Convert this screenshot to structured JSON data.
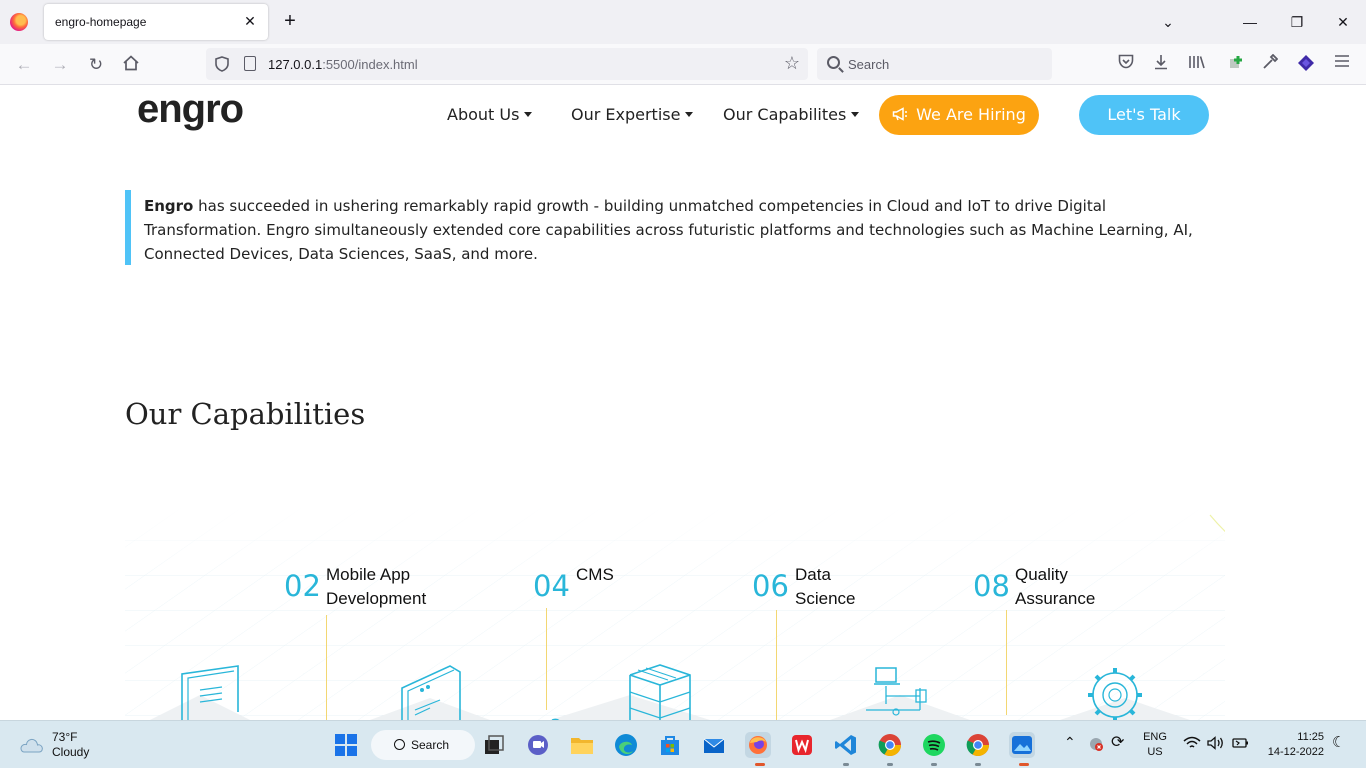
{
  "browser": {
    "tab_title": "engro-homepage",
    "tab_close": "✕",
    "new_tab": "+",
    "url_host": "127.0.0.1",
    "url_rest": ":5500/index.html",
    "search_placeholder": "Search",
    "window_controls": {
      "minimize": "—",
      "restore": "❐",
      "close": "✕"
    },
    "list_tabs": "⌄"
  },
  "site": {
    "logo": "engro",
    "nav": [
      {
        "label": "About Us"
      },
      {
        "label": "Our Expertise"
      },
      {
        "label": "Our Capabilites"
      }
    ],
    "hiring_button": "We Are Hiring",
    "talk_button": "Let's Talk",
    "intro_bold": "Engro",
    "intro_text": " has succeeded in ushering remarkably rapid growth - building unmatched competencies in Cloud and IoT to drive Digital Transformation. Engro simultaneously extended core capabilities across futuristic platforms and technologies such as Machine Learning, AI, Connected Devices, Data Sciences, SaaS, and more.",
    "capabilities_heading": "Our Capabilities",
    "capabilities": [
      {
        "number": "02",
        "line1": "Mobile App",
        "line2": "Development"
      },
      {
        "number": "04",
        "line1": "CMS",
        "line2": ""
      },
      {
        "number": "06",
        "line1": "Data",
        "line2": "Science"
      },
      {
        "number": "08",
        "line1": "Quality",
        "line2": "Assurance"
      }
    ],
    "accent_colors": {
      "blue": "#4fc3f7",
      "orange": "#fca311",
      "number_blue": "#29b6d9"
    }
  },
  "taskbar": {
    "weather_temp": "73°F",
    "weather_desc": "Cloudy",
    "search_label": "Search",
    "lang_top": "ENG",
    "lang_bottom": "US",
    "time": "11:25",
    "date": "14-12-2022"
  }
}
